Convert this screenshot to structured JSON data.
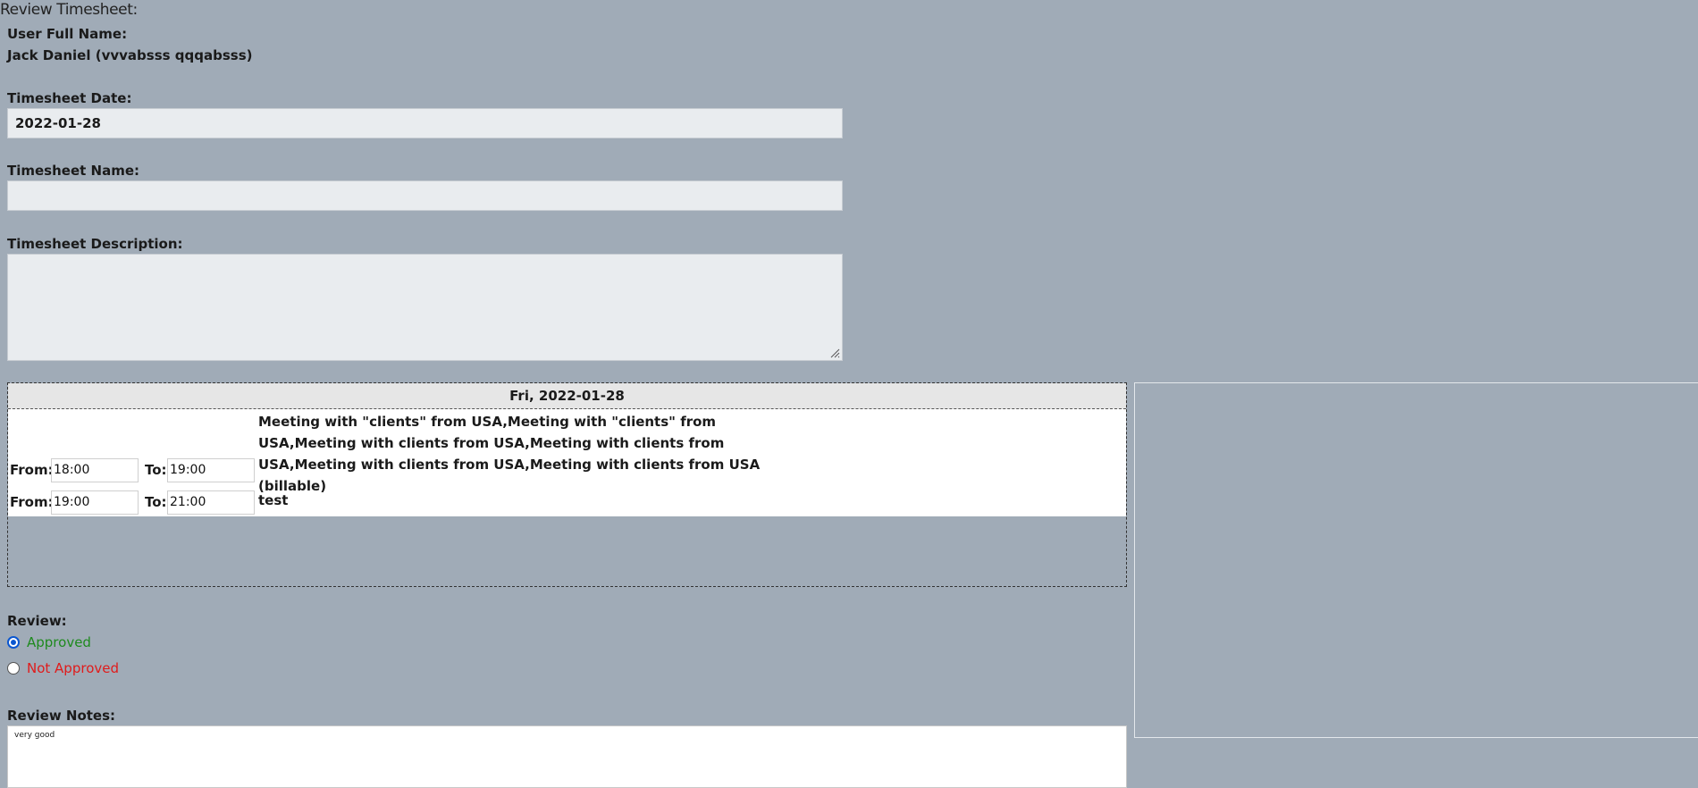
{
  "page": {
    "title": "Review Timesheet:"
  },
  "user": {
    "label": "User Full Name:",
    "value": "Jack Daniel (vvvabsss qqqabsss)"
  },
  "timesheet_date": {
    "label": "Timesheet Date:",
    "value": "2022-01-28"
  },
  "timesheet_name": {
    "label": "Timesheet Name:",
    "value": ""
  },
  "timesheet_description": {
    "label": "Timesheet Description:",
    "value": ""
  },
  "day": {
    "header": "Fri, 2022-01-28",
    "from_label": "From:",
    "to_label": "To:",
    "entries": [
      {
        "from": "18:00",
        "to": "19:00",
        "description": "Meeting with \"clients\" from USA,Meeting with \"clients\" from USA,Meeting with clients from USA,Meeting with clients from USA,Meeting with clients from USA,Meeting with clients from USA (billable)"
      },
      {
        "from": "19:00",
        "to": "21:00",
        "description": "test"
      }
    ]
  },
  "review": {
    "label": "Review:",
    "options": [
      {
        "label": "Approved",
        "checked": true,
        "color": "#1e8a1e"
      },
      {
        "label": "Not Approved",
        "checked": false,
        "color": "#e01b1b"
      }
    ]
  },
  "review_notes": {
    "label": "Review Notes:",
    "value": "very good"
  },
  "colors": {
    "background": "#a0abb7",
    "field_background": "#e9ecef",
    "day_header_background": "#e6e6e6",
    "radio_accent": "#0b57d0"
  }
}
